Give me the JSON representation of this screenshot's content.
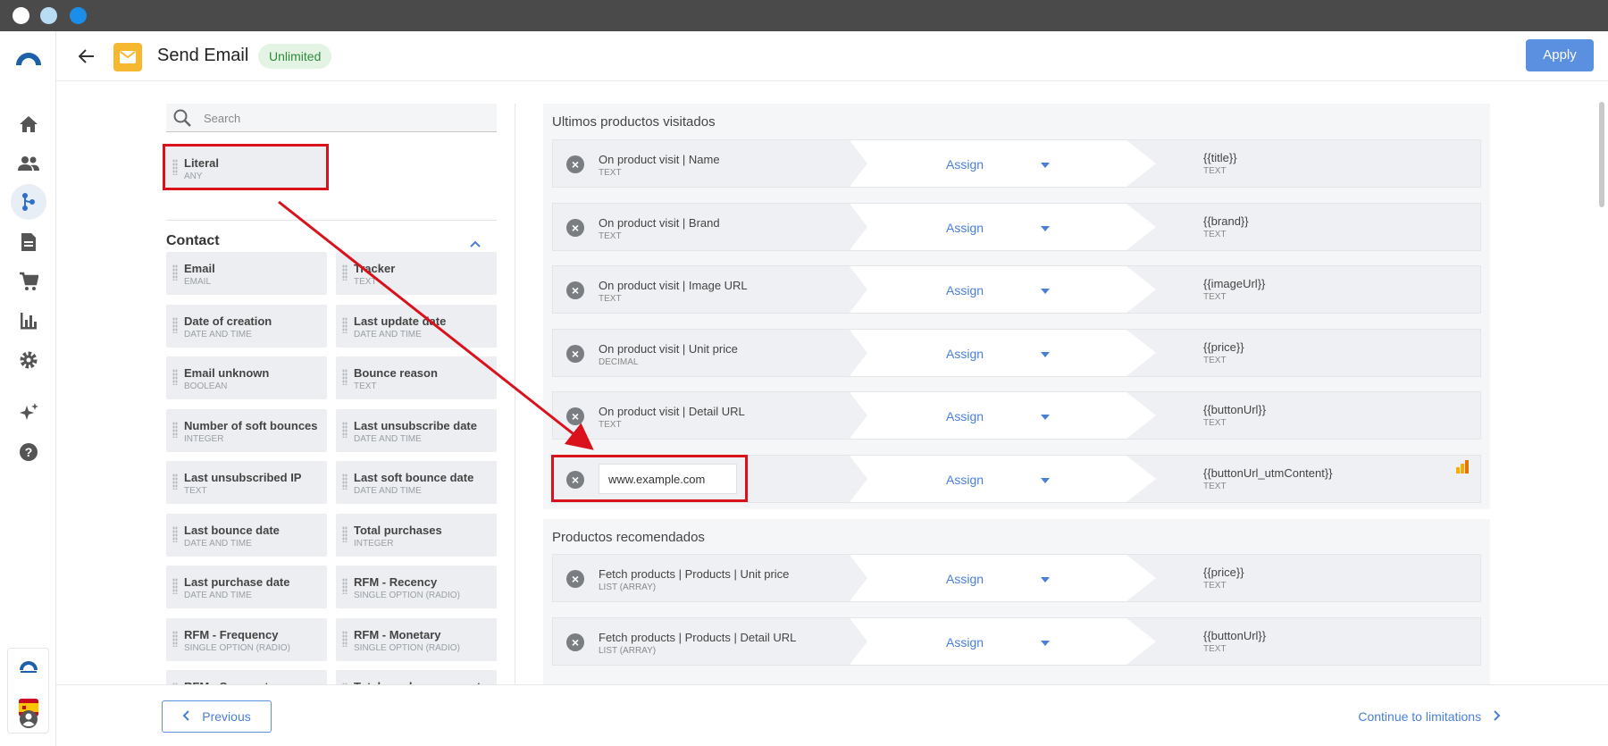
{
  "header": {
    "title": "Send Email",
    "badge": "Unlimited",
    "apply_label": "Apply"
  },
  "search": {
    "placeholder": "Search"
  },
  "literal": {
    "name": "Literal",
    "type": "ANY"
  },
  "contact": {
    "section_title": "Contact",
    "fields": [
      {
        "name": "Email",
        "type": "EMAIL"
      },
      {
        "name": "Tracker",
        "type": "TEXT"
      },
      {
        "name": "Date of creation",
        "type": "DATE AND TIME"
      },
      {
        "name": "Last update date",
        "type": "DATE AND TIME"
      },
      {
        "name": "Email unknown",
        "type": "BOOLEAN"
      },
      {
        "name": "Bounce reason",
        "type": "TEXT"
      },
      {
        "name": "Number of soft bounces",
        "type": "INTEGER"
      },
      {
        "name": "Last unsubscribe date",
        "type": "DATE AND TIME"
      },
      {
        "name": "Last unsubscribed IP",
        "type": "TEXT"
      },
      {
        "name": "Last soft bounce date",
        "type": "DATE AND TIME"
      },
      {
        "name": "Last bounce date",
        "type": "DATE AND TIME"
      },
      {
        "name": "Total purchases",
        "type": "INTEGER"
      },
      {
        "name": "Last purchase date",
        "type": "DATE AND TIME"
      },
      {
        "name": "RFM - Recency",
        "type": "SINGLE OPTION (RADIO)"
      },
      {
        "name": "RFM - Frequency",
        "type": "SINGLE OPTION (RADIO)"
      },
      {
        "name": "RFM - Monetary",
        "type": "SINGLE OPTION (RADIO)"
      },
      {
        "name": "RFM - Segment",
        "type": ""
      },
      {
        "name": "Total purchase amount",
        "type": ""
      }
    ]
  },
  "groups": [
    {
      "title": "Ultimos productos visitados",
      "rows": [
        {
          "left": "On product visit | Name",
          "left_type": "TEXT",
          "assign": "Assign",
          "right": "{{title}}",
          "right_type": "TEXT"
        },
        {
          "left": "On product visit | Brand",
          "left_type": "TEXT",
          "assign": "Assign",
          "right": "{{brand}}",
          "right_type": "TEXT"
        },
        {
          "left": "On product visit | Image URL",
          "left_type": "TEXT",
          "assign": "Assign",
          "right": "{{imageUrl}}",
          "right_type": "TEXT"
        },
        {
          "left": "On product visit | Unit price",
          "left_type": "DECIMAL",
          "assign": "Assign",
          "right": "{{price}}",
          "right_type": "TEXT"
        },
        {
          "left": "On product visit | Detail URL",
          "left_type": "TEXT",
          "assign": "Assign",
          "right": "{{buttonUrl}}",
          "right_type": "TEXT"
        },
        {
          "input_value": "www.example.com",
          "assign": "Assign",
          "right": "{{buttonUrl_utmContent}}",
          "right_type": "TEXT"
        }
      ]
    },
    {
      "title": "Productos recomendados",
      "rows": [
        {
          "left": "Fetch products | Products | Unit price",
          "left_type": "LIST (ARRAY)",
          "assign": "Assign",
          "right": "{{price}}",
          "right_type": "TEXT"
        },
        {
          "left": "Fetch products | Products | Detail URL",
          "left_type": "LIST (ARRAY)",
          "assign": "Assign",
          "right": "{{buttonUrl}}",
          "right_type": "TEXT"
        }
      ]
    }
  ],
  "footer": {
    "previous_label": "Previous",
    "continue_label": "Continue to limitations"
  },
  "colors": {
    "accent": "#5b8fe0",
    "highlight": "#d9121b",
    "badge_bg": "#e4f4e4",
    "badge_text": "#2f8a3b",
    "mail_icon": "#f5b82e"
  },
  "icons": [
    "home-icon",
    "contacts-icon",
    "flow-icon",
    "document-icon",
    "cart-icon",
    "chart-icon",
    "gear-icon",
    "sparkle-icon",
    "help-icon",
    "account-icon",
    "search-icon",
    "mail-icon",
    "back-arrow-icon",
    "remove-icon",
    "analytics-icon"
  ]
}
